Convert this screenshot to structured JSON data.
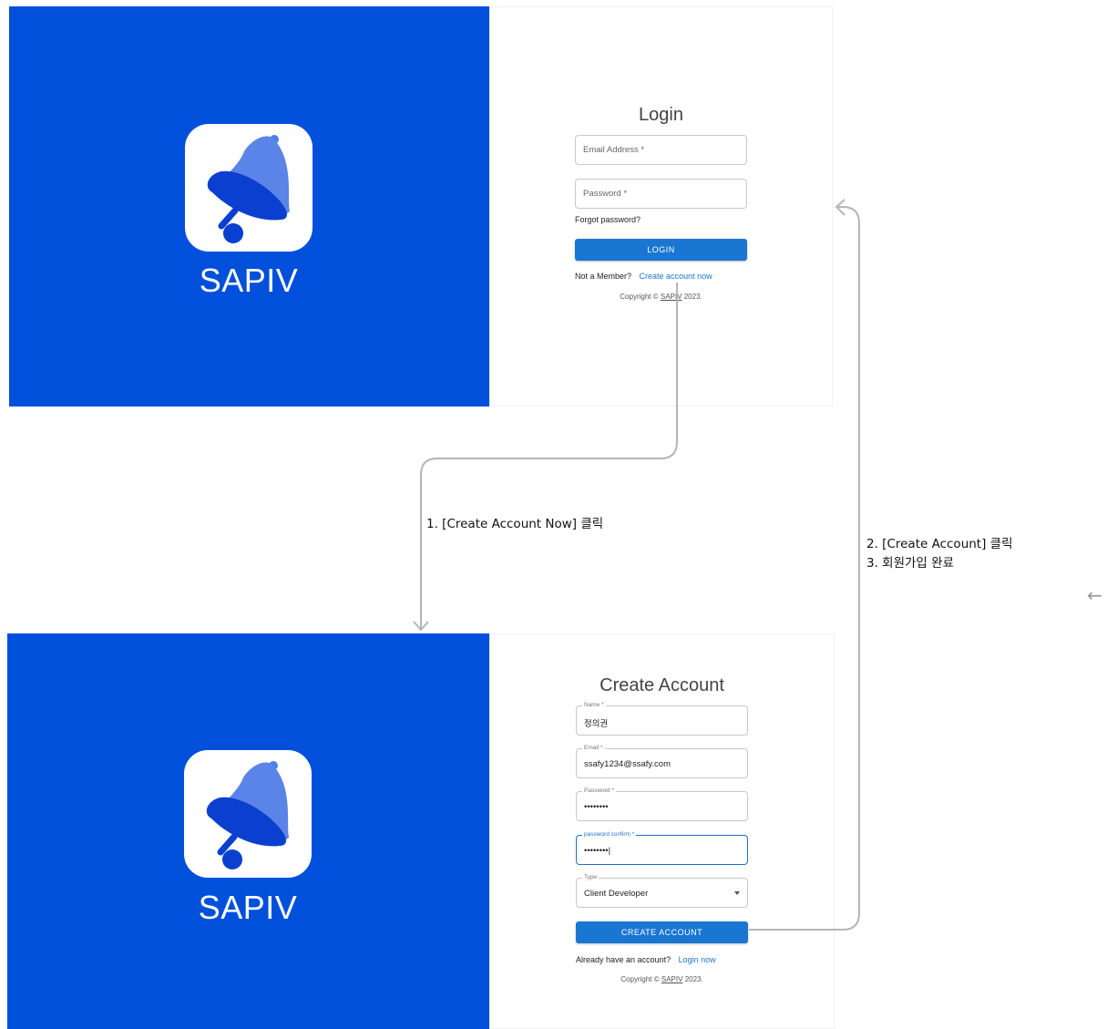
{
  "brand": "SAPIV",
  "colors": {
    "panel_blue": "#0050dc",
    "button_blue": "#1976d2",
    "link_blue": "#1976d2",
    "focus_blue": "#1f6fd1"
  },
  "login": {
    "title": "Login",
    "email_placeholder": "Email Address *",
    "password_placeholder": "Password *",
    "forgot_link": "Forgot password?",
    "login_button": "LOGIN",
    "not_member": "Not a Member?",
    "create_link": "Create account now",
    "copyright_prefix": "Copyright ©",
    "copyright_brand": "SAPIV",
    "copyright_year": "2023."
  },
  "signup": {
    "title": "Create Account",
    "name_label": "Name *",
    "name_value": "정의권",
    "email_label": "Email *",
    "email_value": "ssafy1234@ssafy.com",
    "password_label": "Password *",
    "password_value": "••••••••",
    "confirm_label": "password confirm *",
    "confirm_value": "••••••••|",
    "type_label": "Type",
    "type_value": "Client Developer",
    "create_button": "CREATE ACCOUNT",
    "have_account": "Already have an account?",
    "login_link": "Login now",
    "copyright_prefix": "Copyright ©",
    "copyright_brand": "SAPIV",
    "copyright_year": "2023."
  },
  "annotations": {
    "step1": "1. [Create Account Now] 클릭",
    "step2": "2. [Create Account] 클릭",
    "step3": "3. 회원가입 완료"
  },
  "icons": {
    "logo": "bell-icon",
    "caret": "chevron-down-icon",
    "back": "arrow-left-icon"
  },
  "back_arrow_glyph": "←"
}
